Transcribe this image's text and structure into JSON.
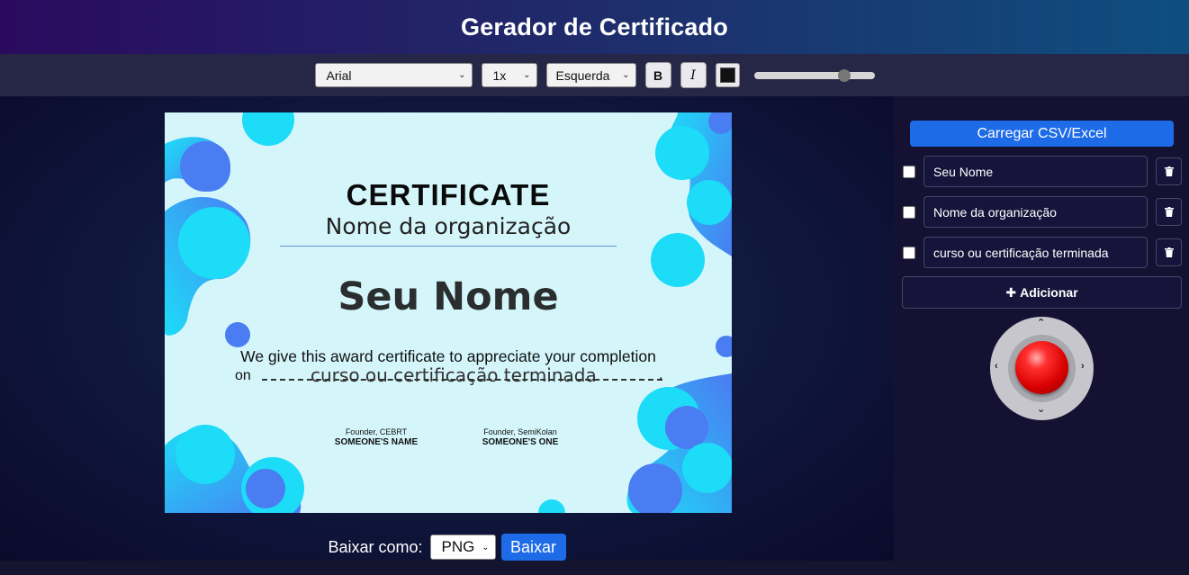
{
  "header": {
    "title": "Gerador de Certificado"
  },
  "toolbar": {
    "font": "Arial",
    "size": "1x",
    "align": "Esquerda",
    "bold_label": "B",
    "italic_label": "I",
    "color": "#111111",
    "slider_level": 0.78
  },
  "certificate": {
    "title": "CERTIFICATE",
    "organization": "Nome da organização",
    "name": "Seu Nome",
    "text": "We give this award certificate to appreciate your completion",
    "on": "on",
    "course": "curso ou certificação terminada",
    "sig1_title": "Founder, CEBRT",
    "sig1_name": "SOMEONE'S NAME",
    "sig2_title": "Founder, SemiKolan",
    "sig2_name": "SOMEONE'S ONE"
  },
  "download": {
    "label": "Baixar como:",
    "format": "PNG",
    "button": "Baixar"
  },
  "sidebar": {
    "upload": "Carregar CSV/Excel",
    "fields": [
      {
        "value": "Seu Nome"
      },
      {
        "value": "Nome da organização"
      },
      {
        "value": "curso ou certificação terminada"
      }
    ],
    "add": "Adicionar"
  },
  "colors": {
    "accent": "#1e6be8",
    "header_start": "#2a0a5e",
    "header_end": "#0e4f7f",
    "cert_bg": "#d4f6fb",
    "blob_light": "#1ddcf7",
    "blob_dark": "#4a7cf2"
  }
}
